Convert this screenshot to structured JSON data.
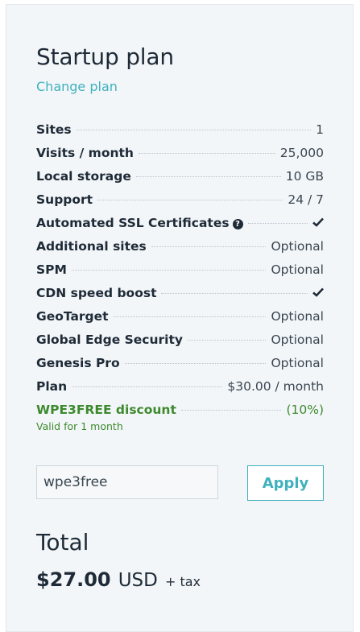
{
  "plan": {
    "title": "Startup plan",
    "change_label": "Change plan"
  },
  "rows": [
    {
      "label": "Sites",
      "value": "1"
    },
    {
      "label": "Visits / month",
      "value": "25,000"
    },
    {
      "label": "Local storage",
      "value": "10 GB"
    },
    {
      "label": "Support",
      "value": "24 / 7"
    },
    {
      "label": "Automated SSL Certificates",
      "value": "",
      "icon": "check-icon",
      "label_icon": "help-icon"
    },
    {
      "label": "Additional sites",
      "value": "Optional"
    },
    {
      "label": "SPM",
      "value": "Optional"
    },
    {
      "label": "CDN speed boost",
      "value": "",
      "icon": "check-icon"
    },
    {
      "label": "GeoTarget",
      "value": "Optional"
    },
    {
      "label": "Global Edge Security",
      "value": "Optional"
    },
    {
      "label": "Genesis Pro",
      "value": "Optional"
    },
    {
      "label": "Plan",
      "value": "$30.00 / month"
    },
    {
      "label": "WPE3FREE discount",
      "value": "(10%)"
    }
  ],
  "discount_note": "Valid for 1 month",
  "coupon": {
    "value": "wpe3free",
    "apply_label": "Apply"
  },
  "total": {
    "label": "Total",
    "amount": "$27.00",
    "currency": "USD",
    "tax": "+ tax"
  },
  "colors": {
    "accent": "#3fb1bd",
    "discount": "#3d8a2e",
    "text": "#1e2b37",
    "panel": "#f3f6f9"
  }
}
